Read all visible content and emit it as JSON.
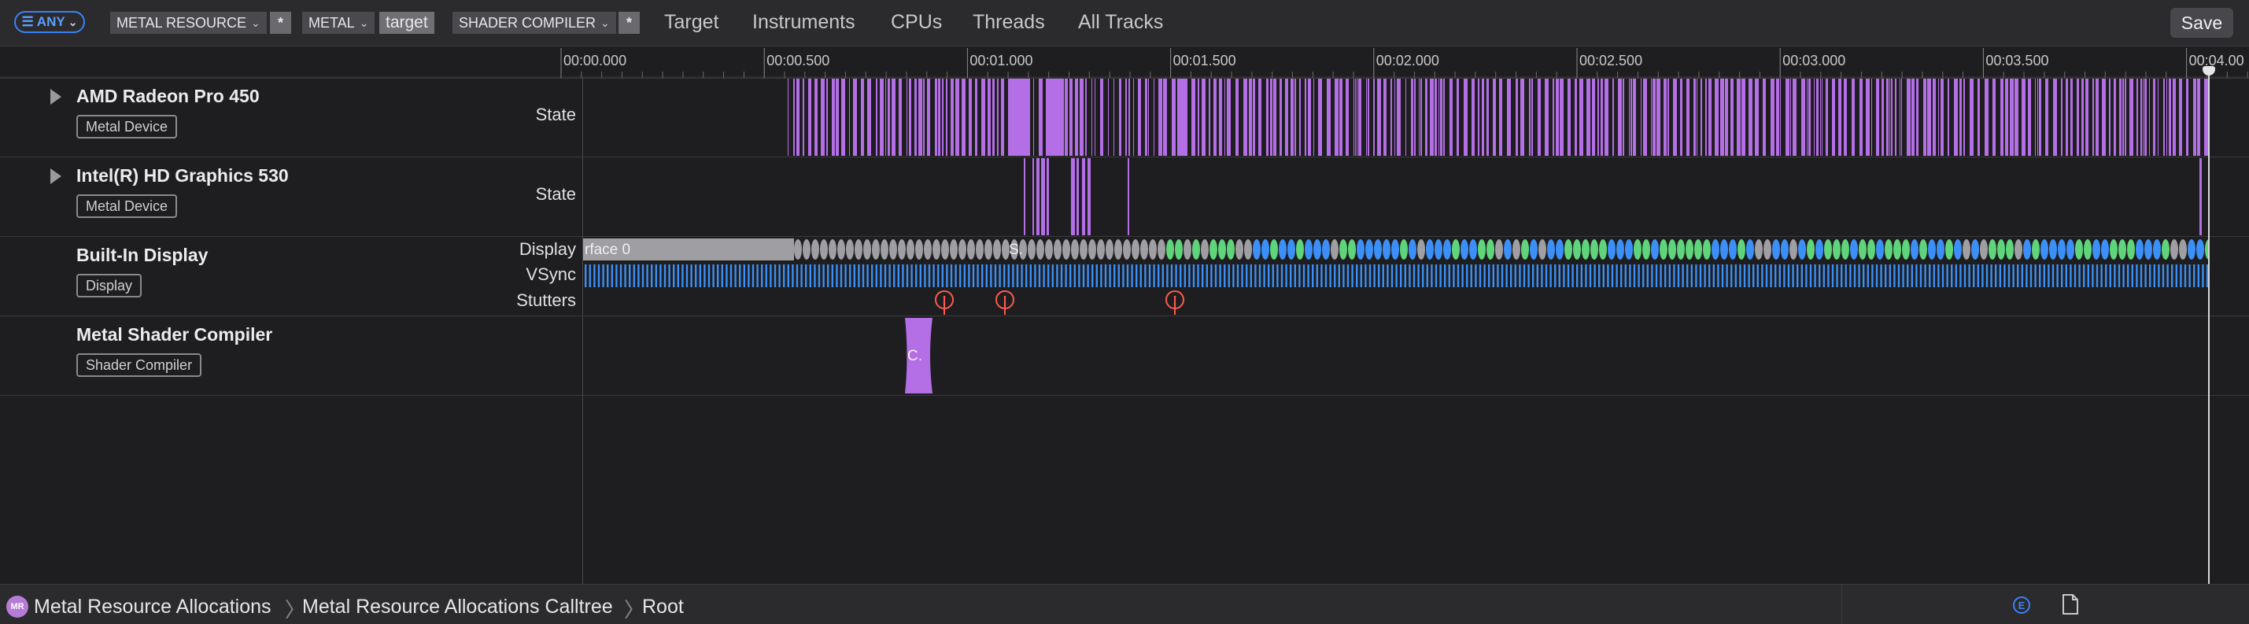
{
  "filter_bar": {
    "any_label": "ANY",
    "tokens": [
      {
        "label": "METAL RESOURCE",
        "kind": "field"
      },
      {
        "label": "*",
        "kind": "op"
      },
      {
        "label": "METAL",
        "kind": "field"
      },
      {
        "label": "target",
        "kind": "value"
      },
      {
        "label": "SHADER COMPILER",
        "kind": "field"
      },
      {
        "label": "*",
        "kind": "op"
      }
    ],
    "scope_tabs": [
      "Target",
      "Instruments",
      "CPUs",
      "Threads",
      "All Tracks"
    ],
    "save_label": "Save"
  },
  "ruler": {
    "ticks": [
      "00:00.000",
      "00:00.500",
      "00:01.000",
      "00:01.500",
      "00:02.000",
      "00:02.500",
      "00:03.000",
      "00:03.500",
      "00:04.00"
    ]
  },
  "tracks": [
    {
      "title": "AMD Radeon Pro 450",
      "badge": "Metal Device",
      "lanes": [
        "State"
      ],
      "expandable": true
    },
    {
      "title": "Intel(R) HD Graphics 530",
      "badge": "Metal Device",
      "lanes": [
        "State"
      ],
      "expandable": true
    },
    {
      "title": "Built-In Display",
      "badge": "Display",
      "lanes": [
        "Display",
        "VSync",
        "Stutters"
      ],
      "expandable": false
    },
    {
      "title": "Metal Shader Compiler",
      "badge": "Shader Compiler",
      "lanes": [],
      "expandable": false
    }
  ],
  "display_lane": {
    "surface_label": "rface 0",
    "mid_label": "S."
  },
  "stutters_lane": {
    "marker_glyph": "!"
  },
  "shader_lane": {
    "block_label": "C."
  },
  "bottom_bar": {
    "app_icon_text": "MR",
    "breadcrumbs": [
      "Metal Resource Allocations",
      "Metal Resource Allocations Calltree",
      "Root"
    ],
    "e_icon_text": "E"
  },
  "colors": {
    "state_purple": "#b46ee6",
    "vsync_blue": "#3b8ff6",
    "frame_green": "#5fd47a",
    "frame_gray": "#9e9ea3",
    "stutter_red": "#ff5a4e",
    "accent_blue": "#3b82f6"
  }
}
